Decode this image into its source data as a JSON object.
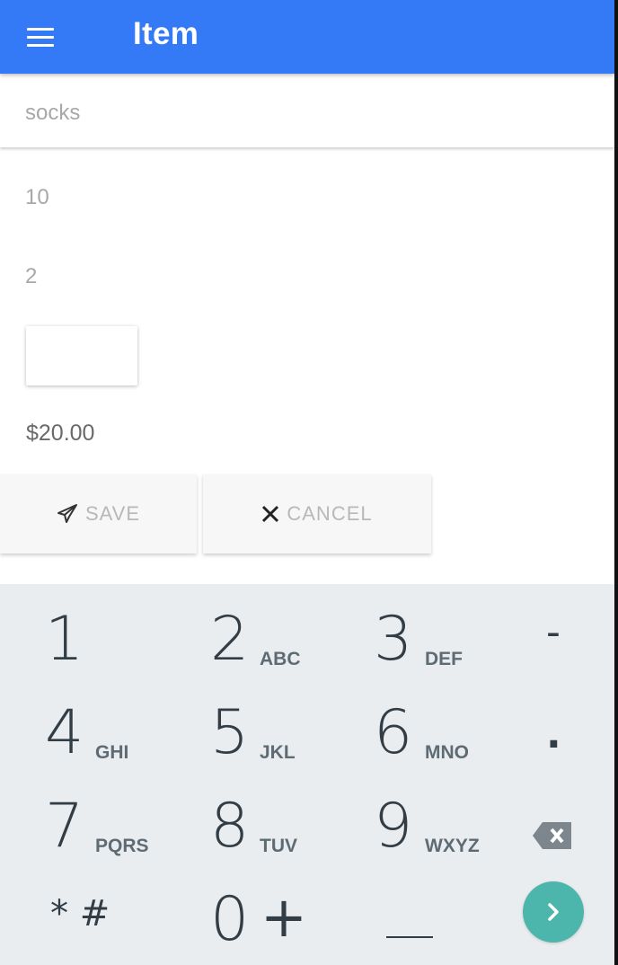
{
  "appbar": {
    "title": "Item",
    "menu_icon": "hamburger-menu-icon",
    "color": "#3479f5"
  },
  "form": {
    "name_value": "socks",
    "quantity_value": "10",
    "price_value": "2",
    "total": "$20.00"
  },
  "actions": {
    "save_label": "SAVE",
    "save_icon": "send-icon",
    "cancel_label": "CANCEL",
    "cancel_icon": "close-icon"
  },
  "keypad": {
    "keys": [
      {
        "digit": "1",
        "letters": ""
      },
      {
        "digit": "2",
        "letters": "ABC"
      },
      {
        "digit": "3",
        "letters": "DEF"
      },
      {
        "digit": "4",
        "letters": "GHI"
      },
      {
        "digit": "5",
        "letters": "JKL"
      },
      {
        "digit": "6",
        "letters": "MNO"
      },
      {
        "digit": "7",
        "letters": "PQRS"
      },
      {
        "digit": "8",
        "letters": "TUV"
      },
      {
        "digit": "9",
        "letters": "WXYZ"
      },
      {
        "digit": "0",
        "letters": "+"
      }
    ],
    "star_hash": "* #",
    "minus": "-",
    "dot": ".",
    "backspace_icon": "backspace-icon",
    "space_icon": "space-bar-icon",
    "go_icon": "chevron-right-icon",
    "go_color": "#4db6ac",
    "background": "#e9edf0"
  }
}
